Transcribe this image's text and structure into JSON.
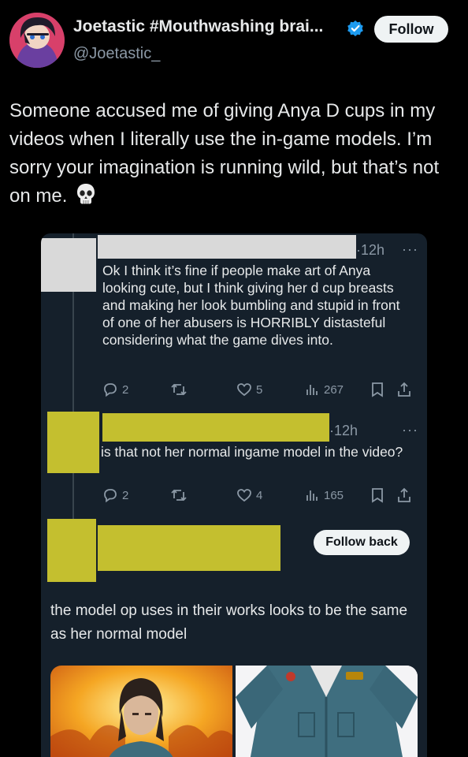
{
  "tweet": {
    "display_name": "Joetastic #Mouthwashing brai...",
    "handle": "@Joetastic_",
    "follow_label": "Follow",
    "text": "Someone accused me of giving Anya D cups in my videos when I literally use the in-game models. I’m sorry your imagination is running wild, but that’s not on me.",
    "emoji": "skull-icon"
  },
  "embedded": {
    "replies": [
      {
        "time": "·12h",
        "text": "Ok I think it’s fine if people make art of Anya looking cute, but I think giving her d cup breasts and making her look bumbling and stupid in front of one of her abusers is HORRIBLY distasteful considering what the game dives into.",
        "replies": "2",
        "likes": "5",
        "views": "267"
      },
      {
        "time": "·12h",
        "text": "is that not her normal ingame model in the video?",
        "replies": "2",
        "likes": "4",
        "views": "165"
      }
    ],
    "third": {
      "follow_back_label": "Follow back",
      "text": "the model op uses in their works looks to be the same as her normal model"
    }
  },
  "colors": {
    "background": "#000000",
    "card": "#15202b",
    "muted": "#8b98a5",
    "verified": "#1d9bf0",
    "redaction_yellow": "#c4bf2f",
    "redaction_gray": "#d9d9d9"
  }
}
